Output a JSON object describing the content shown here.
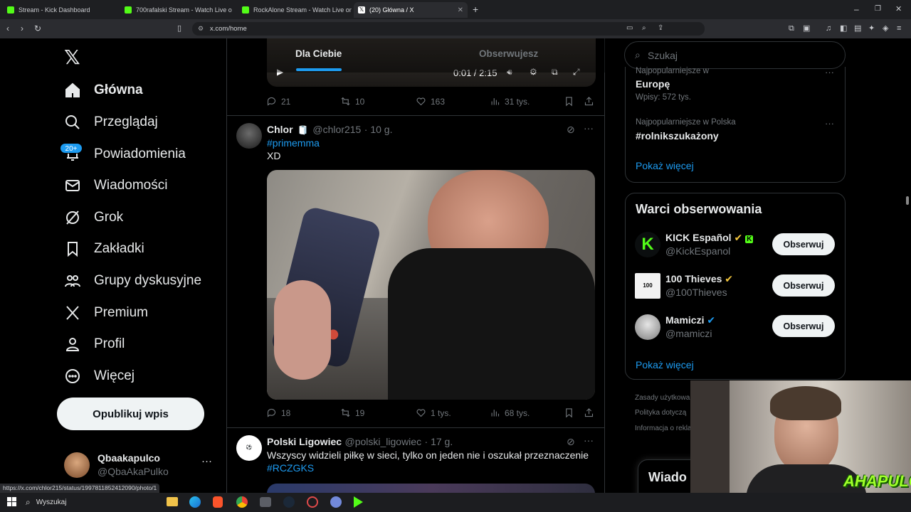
{
  "browser": {
    "tabs": [
      {
        "title": "Stream - Kick Dashboard",
        "color": "#53fc18"
      },
      {
        "title": "700rafalski Stream - Watch Live o",
        "color": "#53fc18"
      },
      {
        "title": "RockAlone Stream - Watch Live on Ki",
        "color": "#53fc18"
      },
      {
        "title": "(20) Główna / X",
        "color": "#ffffff"
      }
    ],
    "url": "x.com/home",
    "status_url": "https://x.com/chlor215/status/1997811852412090/photo/1"
  },
  "nav": {
    "items": [
      {
        "label": "Główna",
        "icon": "home-icon"
      },
      {
        "label": "Przeglądaj",
        "icon": "search-icon"
      },
      {
        "label": "Powiadomienia",
        "icon": "bell-icon"
      },
      {
        "label": "Wiadomości",
        "icon": "mail-icon"
      },
      {
        "label": "Grok",
        "icon": "grok-icon"
      },
      {
        "label": "Zakładki",
        "icon": "bookmark-icon"
      },
      {
        "label": "Grupy dyskusyjne",
        "icon": "people-icon"
      },
      {
        "label": "Premium",
        "icon": "x-logo-icon"
      },
      {
        "label": "Profil",
        "icon": "person-icon"
      },
      {
        "label": "Więcej",
        "icon": "more-circle-icon"
      }
    ],
    "notif_badge": "20+",
    "post_button": "Opublikuj wpis",
    "account": {
      "name": "Qbaakapulco",
      "handle": "@QbaAkaPulko"
    }
  },
  "feed": {
    "tabs": [
      "Dla Ciebie",
      "Obserwujesz"
    ],
    "video_time": "0:01 / 2:15",
    "prev_tweet_stats": {
      "replies": "21",
      "reposts": "10",
      "likes": "163",
      "views": "31 tys."
    },
    "tweet1": {
      "name": "Chlor",
      "handle": "@chlor215",
      "time": "· 10 g.",
      "hashtag": "#primemma",
      "text": "XD",
      "stats": {
        "replies": "18",
        "reposts": "19",
        "likes": "1 tys.",
        "views": "68 tys."
      }
    },
    "tweet2": {
      "name": "Polski Ligowiec",
      "handle": "@polski_ligowiec",
      "time": "· 17 g.",
      "text": "Wszyscy widzieli piłkę w sieci, tylko on jeden nie i oszukał przeznaczenie",
      "hashtag": "#RCZGKS"
    }
  },
  "right": {
    "search_placeholder": "Szukaj",
    "trends": [
      {
        "context": "Najpopularniejsze w",
        "title": "Europę",
        "count": "Wpisy: 572 tys."
      },
      {
        "context": "Najpopularniejsze w Polska",
        "title": "#rolnikszukażony",
        "count": ""
      }
    ],
    "trends_more": "Pokaż więcej",
    "who_to_follow_title": "Warci obserwowania",
    "suggestions": [
      {
        "name": "KICK Español",
        "handle": "@KickEspanol",
        "button": "Obserwuj"
      },
      {
        "name": "100 Thieves",
        "handle": "@100Thieves",
        "button": "Obserwuj"
      },
      {
        "name": "Mamiczi",
        "handle": "@mamiczi",
        "button": "Obserwuj"
      }
    ],
    "suggestions_more": "Pokaż więcej",
    "footer": [
      "Zasady użytkowa",
      "Polityka dotyczą",
      "Informacja o rekla"
    ],
    "messages_peek": "Wiado"
  },
  "taskbar": {
    "search_label": "Wyszukaj"
  },
  "overlay": {
    "streamer_logo": "AHAPULCO"
  },
  "colors": {
    "accent": "#1d9bf0",
    "kick": "#53fc18",
    "verified": "#f4c63d"
  }
}
